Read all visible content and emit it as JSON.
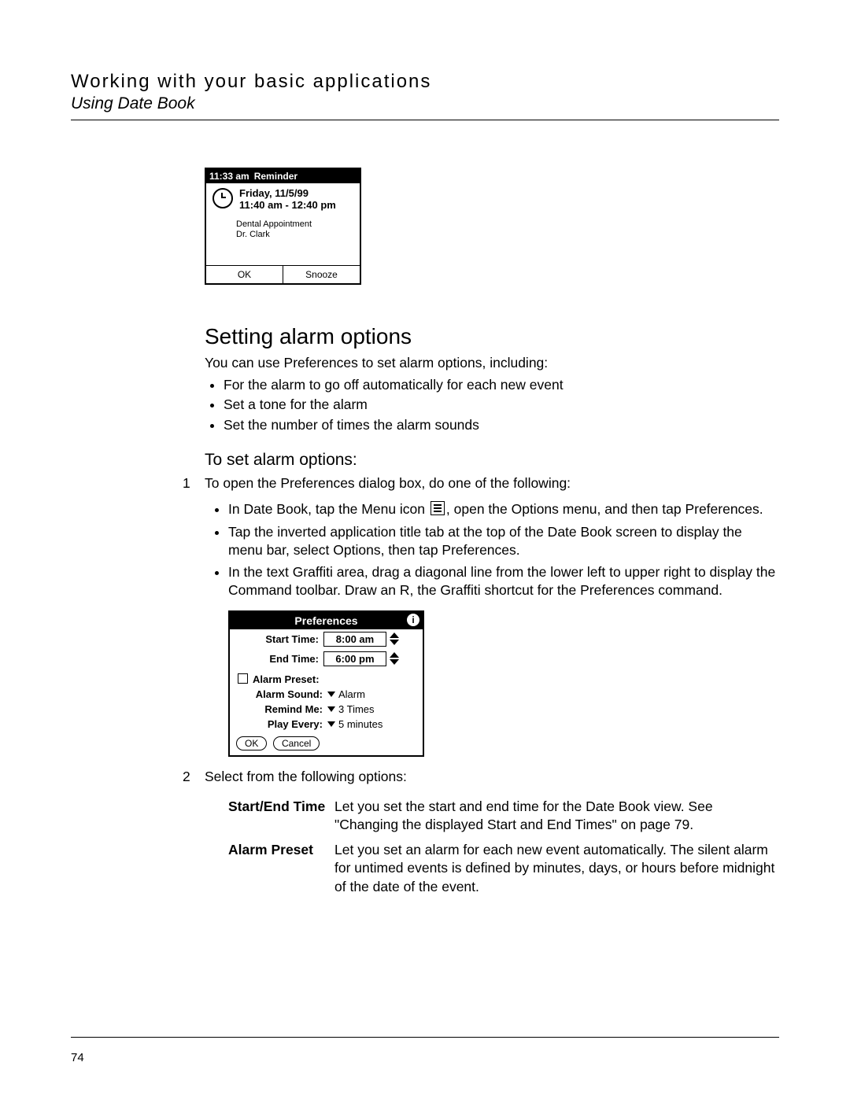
{
  "header": {
    "title": "Working with your basic applications",
    "subtitle": "Using Date Book"
  },
  "reminder": {
    "time": "11:33 am",
    "label": "Reminder",
    "date": "Friday, 11/5/99",
    "range": "11:40 am - 12:40 pm",
    "appt_line1": "Dental Appointment",
    "appt_line2": "Dr. Clark",
    "ok": "OK",
    "snooze": "Snooze"
  },
  "section": {
    "heading": "Setting alarm options",
    "intro": "You can use Preferences to set alarm options, including:",
    "bullets": [
      "For the alarm to go off automatically for each new event",
      "Set a tone for the alarm",
      "Set the number of times the alarm sounds"
    ]
  },
  "procedure": {
    "heading": "To set alarm options:",
    "step1_num": "1",
    "step1_text": "To open the Preferences dialog box, do one of the following:",
    "sub": [
      {
        "pre": "In Date Book, tap the Menu icon ",
        "post": ", open the Options menu, and then tap Preferences."
      },
      {
        "text": "Tap the inverted application title tab at the top of the Date Book screen to display the menu bar, select Options, then tap Preferences."
      },
      {
        "text": "In the text Graffiti area, drag a diagonal line from the lower left to upper right to display the Command toolbar. Draw an R, the Graffiti shortcut for the Preferences command."
      }
    ],
    "step2_num": "2",
    "step2_text": "Select from the following options:"
  },
  "prefs": {
    "title": "Preferences",
    "info": "i",
    "start_label": "Start Time:",
    "start_value": "8:00 am",
    "end_label": "End Time:",
    "end_value": "6:00 pm",
    "alarm_preset_label": "Alarm Preset:",
    "alarm_sound_label": "Alarm Sound:",
    "alarm_sound_value": "Alarm",
    "remind_me_label": "Remind Me:",
    "remind_me_value": "3 Times",
    "play_every_label": "Play Every:",
    "play_every_value": "5 minutes",
    "ok": "OK",
    "cancel": "Cancel"
  },
  "defs": {
    "d1_term": "Start/End Time",
    "d1_body": "Let you set the start and end time for the Date Book view. See \"Changing the displayed Start and End Times\" on page 79.",
    "d2_term": "Alarm Preset",
    "d2_body": "Let you set an alarm for each new event automatically. The silent alarm for untimed events is defined by minutes, days, or hours before midnight of the date of the event."
  },
  "page_number": "74"
}
